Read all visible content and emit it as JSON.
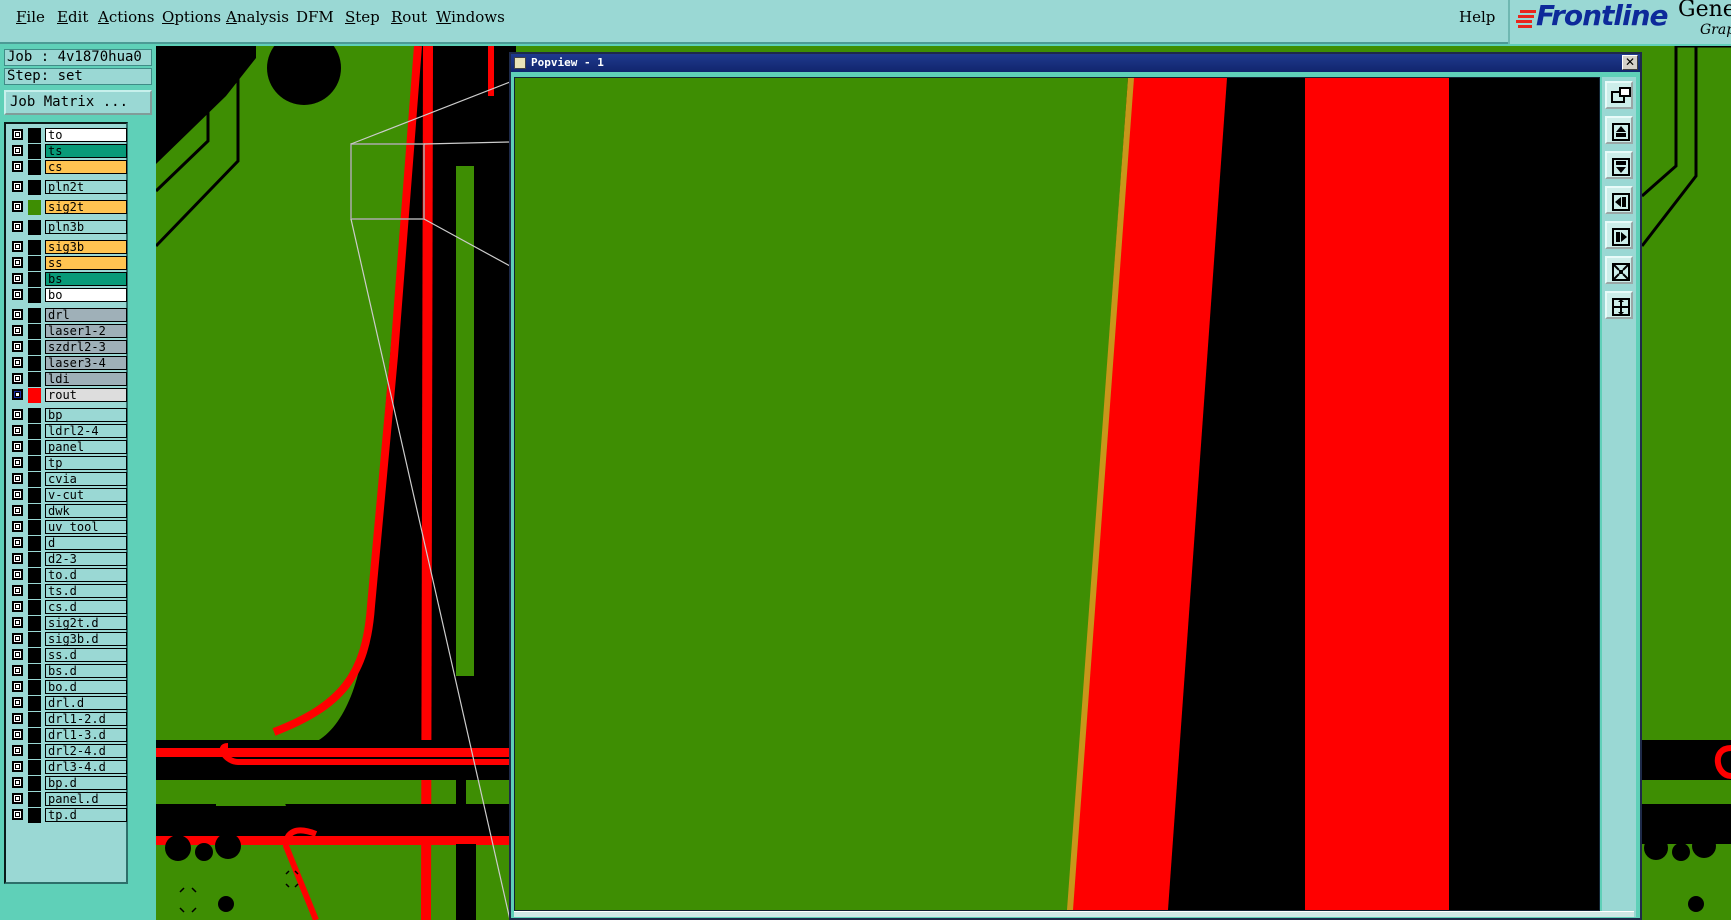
{
  "menubar": {
    "items": [
      {
        "label": "File",
        "ul": "F",
        "rest": "ile"
      },
      {
        "label": "Edit",
        "ul": "E",
        "rest": "dit"
      },
      {
        "label": "Actions",
        "ul": "A",
        "rest": "ctions"
      },
      {
        "label": "Options",
        "ul": "O",
        "rest": "ptions"
      },
      {
        "label": "Analysis",
        "ul": "A",
        "rest": "nalysis"
      },
      {
        "label": "DFM",
        "ul": "",
        "rest": "DFM"
      },
      {
        "label": "Step",
        "ul": "S",
        "rest": "tep"
      },
      {
        "label": "Rout",
        "ul": "R",
        "rest": "out"
      },
      {
        "label": "Windows",
        "ul": "W",
        "rest": "indows"
      }
    ],
    "help": "Help"
  },
  "logo": {
    "brand": "Frontline",
    "product": "Gene",
    "subtitle": "Grap"
  },
  "job": {
    "job_line": "Job : 4v1870hua0",
    "step_line": "Step: set",
    "matrix_button": "Job Matrix ..."
  },
  "layers": [
    {
      "name": "to",
      "color": "#ffffff",
      "sw": "#000000",
      "gap": false
    },
    {
      "name": "ts",
      "color": "#089a78",
      "sw": "#000000",
      "gap": false
    },
    {
      "name": "cs",
      "color": "#ffc451",
      "sw": "#000000",
      "gap": false
    },
    {
      "name": "pln2t",
      "color": "#9ad8d4",
      "sw": "#000000",
      "gap": true
    },
    {
      "name": "sig2t",
      "color": "#ffc451",
      "sw": "#3e8e03",
      "gap": true
    },
    {
      "name": "pln3b",
      "color": "#9ad8d4",
      "sw": "#000000",
      "gap": true
    },
    {
      "name": "sig3b",
      "color": "#ffc451",
      "sw": "#000000",
      "gap": true
    },
    {
      "name": "ss",
      "color": "#ffc451",
      "sw": "#000000",
      "gap": false
    },
    {
      "name": "bs",
      "color": "#089a78",
      "sw": "#000000",
      "gap": false
    },
    {
      "name": "bo",
      "color": "#ffffff",
      "sw": "#000000",
      "gap": false
    },
    {
      "name": "drl",
      "color": "#9fb0b8",
      "sw": "#000000",
      "gap": true
    },
    {
      "name": "laser1-2",
      "color": "#9fb0b8",
      "sw": "#000000",
      "gap": false
    },
    {
      "name": "szdrl2-3",
      "color": "#9fb0b8",
      "sw": "#000000",
      "gap": false
    },
    {
      "name": "laser3-4",
      "color": "#9fb0b8",
      "sw": "#000000",
      "gap": false
    },
    {
      "name": "ldi",
      "color": "#9fb0b8",
      "sw": "#000000",
      "gap": false
    },
    {
      "name": "rout",
      "color": "#dddddd",
      "sw": "#ff0000",
      "gap": false,
      "active": true
    },
    {
      "name": "bp",
      "color": "#9ad8d4",
      "sw": "#000000",
      "gap": true
    },
    {
      "name": "ldrl2-4",
      "color": "#9ad8d4",
      "sw": "#000000",
      "gap": false
    },
    {
      "name": "panel",
      "color": "#9ad8d4",
      "sw": "#000000",
      "gap": false
    },
    {
      "name": "tp",
      "color": "#9ad8d4",
      "sw": "#000000",
      "gap": false
    },
    {
      "name": "cvia",
      "color": "#9ad8d4",
      "sw": "#000000",
      "gap": false
    },
    {
      "name": "v-cut",
      "color": "#9ad8d4",
      "sw": "#000000",
      "gap": false
    },
    {
      "name": "dwk",
      "color": "#9ad8d4",
      "sw": "#000000",
      "gap": false
    },
    {
      "name": "uv_tool",
      "color": "#9ad8d4",
      "sw": "#000000",
      "gap": false
    },
    {
      "name": "d",
      "color": "#9ad8d4",
      "sw": "#000000",
      "gap": false
    },
    {
      "name": "d2-3",
      "color": "#9ad8d4",
      "sw": "#000000",
      "gap": false
    },
    {
      "name": "to.d",
      "color": "#9ad8d4",
      "sw": "#000000",
      "gap": false
    },
    {
      "name": "ts.d",
      "color": "#9ad8d4",
      "sw": "#000000",
      "gap": false
    },
    {
      "name": "cs.d",
      "color": "#9ad8d4",
      "sw": "#000000",
      "gap": false
    },
    {
      "name": "sig2t.d",
      "color": "#9ad8d4",
      "sw": "#000000",
      "gap": false
    },
    {
      "name": "sig3b.d",
      "color": "#9ad8d4",
      "sw": "#000000",
      "gap": false
    },
    {
      "name": "ss.d",
      "color": "#9ad8d4",
      "sw": "#000000",
      "gap": false
    },
    {
      "name": "bs.d",
      "color": "#9ad8d4",
      "sw": "#000000",
      "gap": false
    },
    {
      "name": "bo.d",
      "color": "#9ad8d4",
      "sw": "#000000",
      "gap": false
    },
    {
      "name": "drl.d",
      "color": "#9ad8d4",
      "sw": "#000000",
      "gap": false
    },
    {
      "name": "drl1-2.d",
      "color": "#9ad8d4",
      "sw": "#000000",
      "gap": false
    },
    {
      "name": "drl1-3.d",
      "color": "#9ad8d4",
      "sw": "#000000",
      "gap": false
    },
    {
      "name": "drl2-4.d",
      "color": "#9ad8d4",
      "sw": "#000000",
      "gap": false
    },
    {
      "name": "drl3-4.d",
      "color": "#9ad8d4",
      "sw": "#000000",
      "gap": false
    },
    {
      "name": "bp.d",
      "color": "#9ad8d4",
      "sw": "#000000",
      "gap": false
    },
    {
      "name": "panel.d",
      "color": "#9ad8d4",
      "sw": "#000000",
      "gap": false
    },
    {
      "name": "tp.d",
      "color": "#9ad8d4",
      "sw": "#000000",
      "gap": false
    }
  ],
  "popview": {
    "title": "Popview - 1",
    "close": "✕"
  },
  "toolbar_icons": [
    "zoom-window-icon",
    "zoom-in-icon",
    "zoom-out-icon",
    "pan-left-icon",
    "pan-right-icon",
    "fit-all-icon",
    "fit-center-icon"
  ],
  "colors": {
    "copper": "#3e8e03",
    "rout": "#ff0000",
    "substrate": "#000000",
    "bg": "#5fd0b8"
  }
}
